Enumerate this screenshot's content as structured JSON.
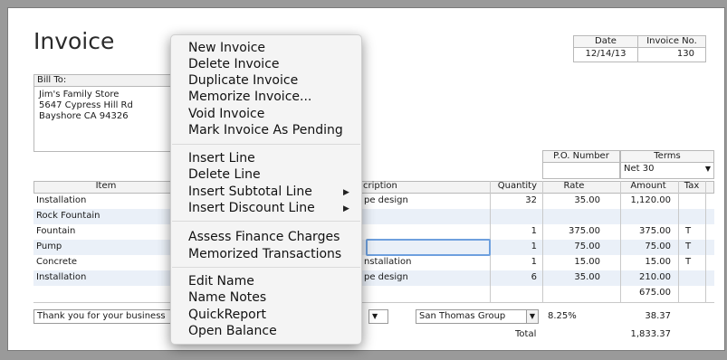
{
  "form": {
    "title": "Invoice",
    "bill_to_label": "Bill To:",
    "bill_to": [
      "Jim's Family Store",
      "5647 Cypress Hill Rd",
      "Bayshore CA 94326"
    ],
    "date_label": "Date",
    "date": "12/14/13",
    "invoice_no_label": "Invoice No.",
    "invoice_no": "130",
    "po_label": "P.O. Number",
    "po_value": "",
    "terms_label": "Terms",
    "terms_value": "Net 30"
  },
  "table": {
    "headers": {
      "item": "Item",
      "description": "cription",
      "quantity": "Quantity",
      "rate": "Rate",
      "amount": "Amount",
      "tax": "Tax"
    },
    "rows": [
      {
        "item": "Installation",
        "description": "pe design",
        "quantity": "32",
        "rate": "35.00",
        "amount": "1,120.00",
        "tax": ""
      },
      {
        "item": "Rock Fountain",
        "description": "",
        "quantity": "",
        "rate": "",
        "amount": "",
        "tax": ""
      },
      {
        "item": "Fountain",
        "description": "",
        "quantity": "1",
        "rate": "375.00",
        "amount": "375.00",
        "tax": "T"
      },
      {
        "item": "Pump",
        "description": "",
        "quantity": "1",
        "rate": "75.00",
        "amount": "75.00",
        "tax": "T"
      },
      {
        "item": "Concrete",
        "description": "nstallation",
        "quantity": "1",
        "rate": "15.00",
        "amount": "15.00",
        "tax": "T"
      },
      {
        "item": "Installation",
        "description": "pe design",
        "quantity": "6",
        "rate": "35.00",
        "amount": "210.00",
        "tax": ""
      },
      {
        "item": "",
        "description": "",
        "quantity": "",
        "rate": "",
        "amount": "675.00",
        "tax": ""
      }
    ]
  },
  "footer": {
    "message": "Thank you for your business",
    "tax_item": "San Thomas Group",
    "tax_rate": "8.25%",
    "tax_amount": "38.37",
    "total_label": "Total",
    "total": "1,833.37"
  },
  "menu": {
    "groups": [
      [
        "New Invoice",
        "Delete Invoice",
        "Duplicate Invoice",
        "Memorize Invoice...",
        "Void Invoice",
        "Mark Invoice As Pending"
      ],
      [
        "Insert Line",
        "Delete Line",
        "Insert Subtotal Line",
        "Insert Discount Line"
      ],
      [
        "Assess Finance Charges",
        "Memorized Transactions"
      ],
      [
        "Edit Name",
        "Name Notes",
        "QuickReport",
        "Open Balance"
      ]
    ],
    "submenu_arrow": "▶"
  }
}
